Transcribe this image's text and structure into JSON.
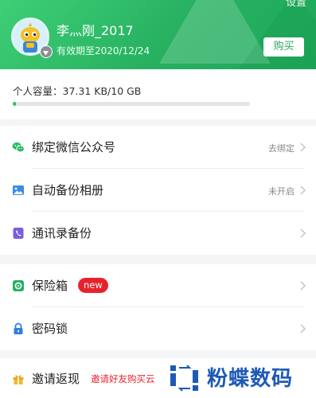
{
  "header": {
    "corner_text": "设置",
    "username": "李灬刚_2017",
    "expiry": "有效期至2020/12/24",
    "buy_label": "购买"
  },
  "storage": {
    "label": "个人容量：37.31 KB/10 GB",
    "used_fraction": 0.015
  },
  "menu": {
    "wechat": {
      "icon": "wechat-icon",
      "label": "绑定微信公众号",
      "value": "去绑定"
    },
    "album": {
      "icon": "album-icon",
      "label": "自动备份相册",
      "value": "未开启"
    },
    "contacts": {
      "icon": "contacts-icon",
      "label": "通讯录备份"
    },
    "safe": {
      "icon": "safe-icon",
      "label": "保险箱",
      "badge": "new"
    },
    "lock": {
      "icon": "lock-icon",
      "label": "密码锁"
    },
    "invite": {
      "icon": "gift-icon",
      "label": "邀请返现",
      "promo": "邀请好友购买云"
    }
  },
  "watermark": {
    "text": "粉蝶数码"
  },
  "colors": {
    "brand_green": "#2aaa5c",
    "badge_red": "#e8222c",
    "watermark_blue": "#1d5ab6"
  }
}
